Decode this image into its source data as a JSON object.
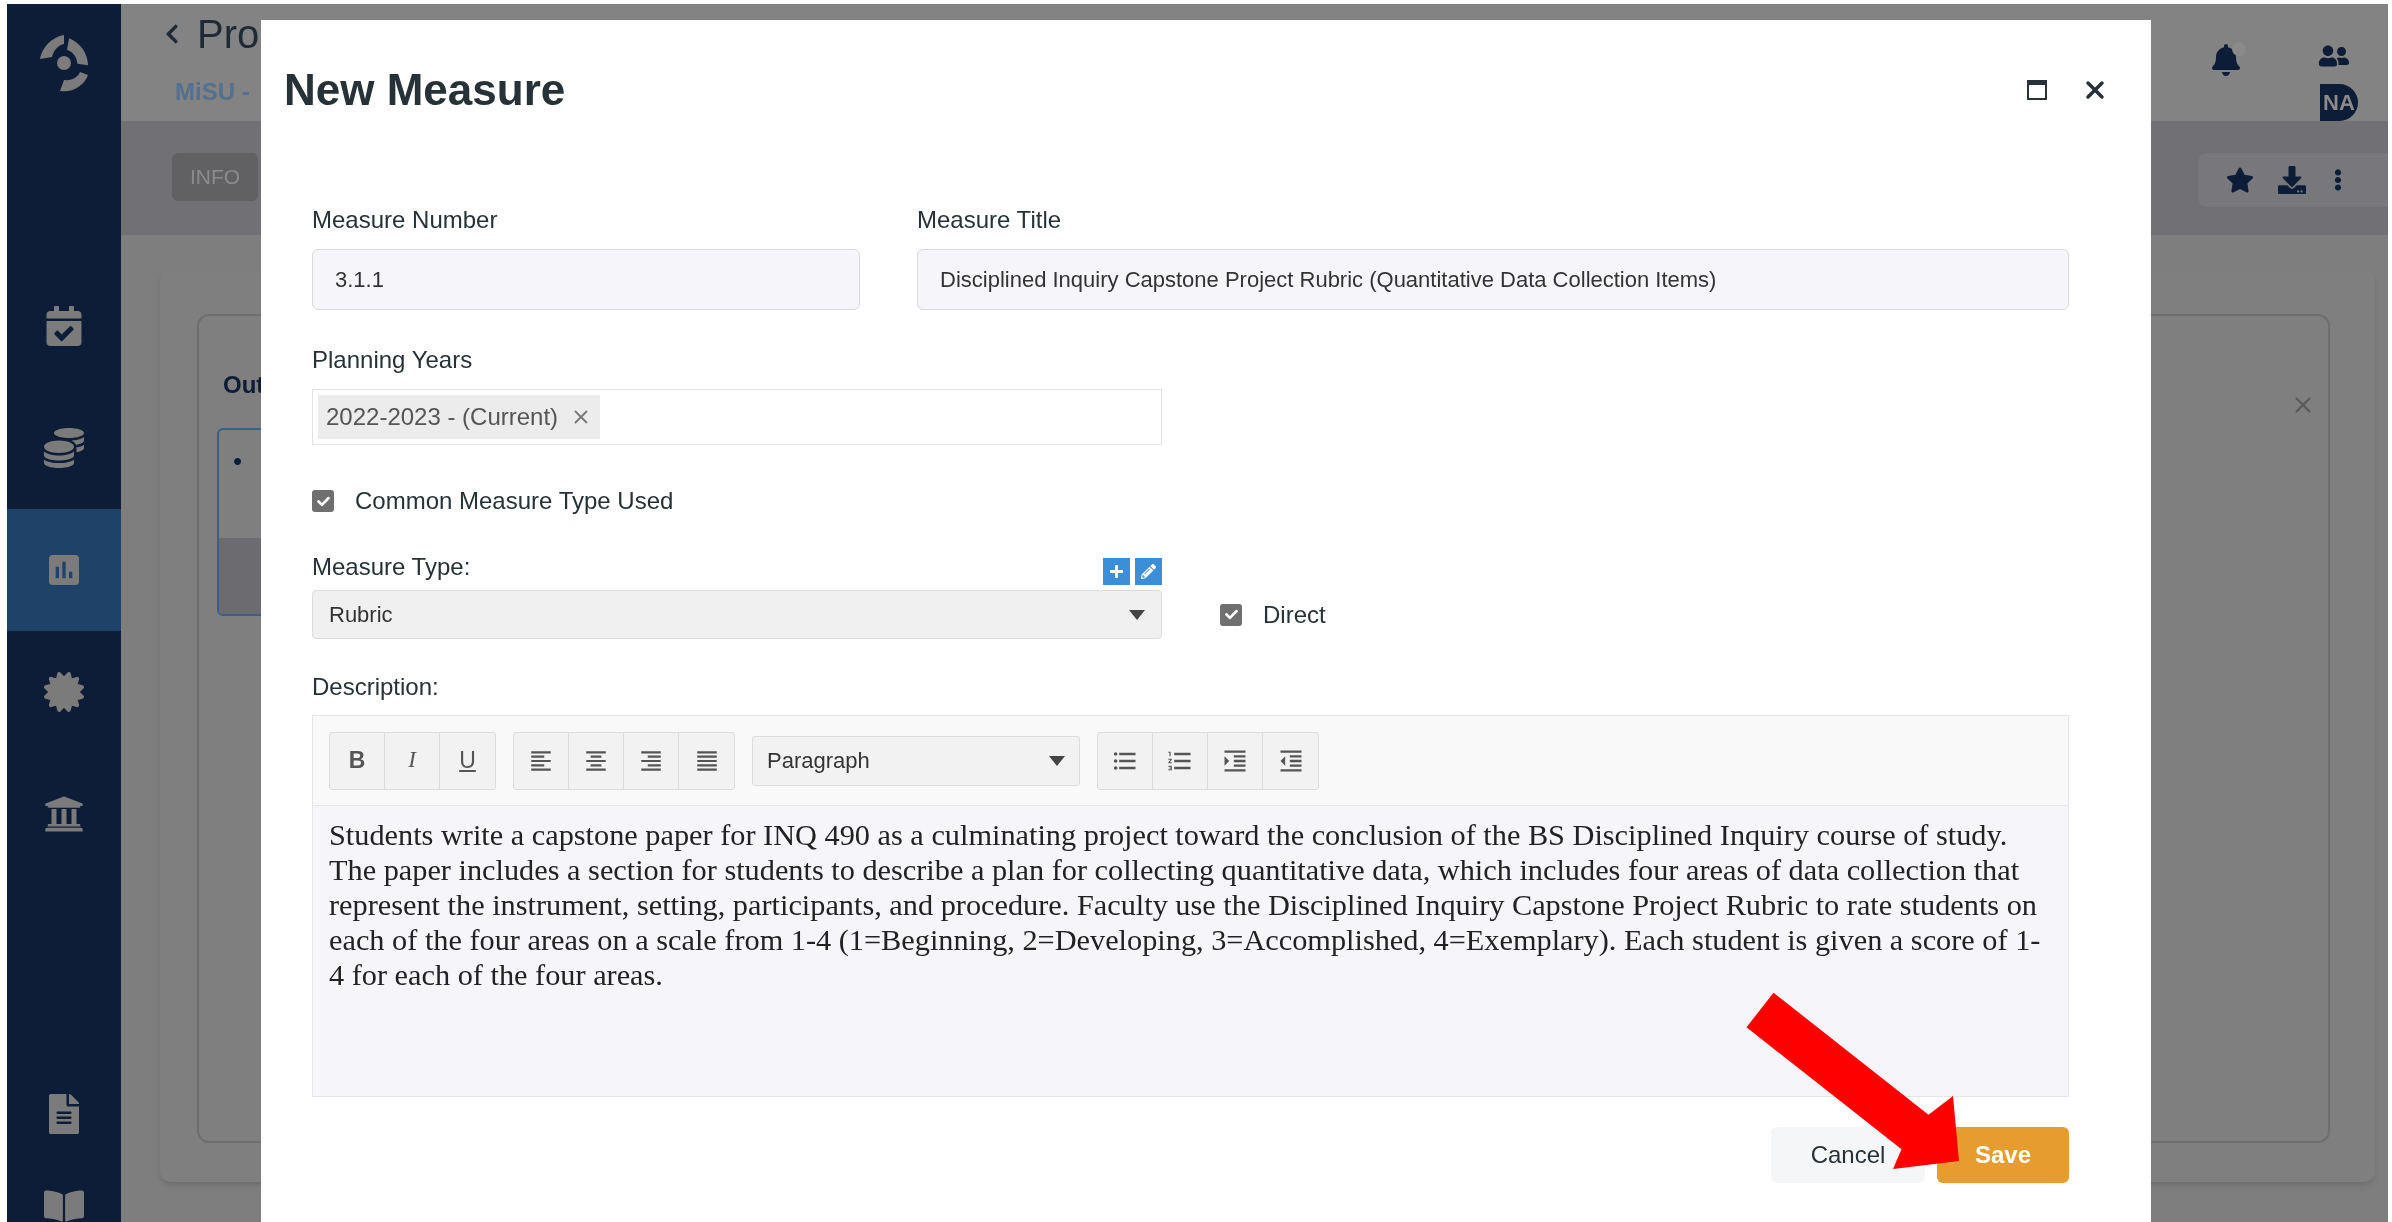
{
  "sidebar": {
    "items": [
      {
        "selected": false
      },
      {
        "selected": false
      },
      {
        "selected": true
      },
      {
        "selected": false
      },
      {
        "selected": false
      },
      {
        "selected": false
      },
      {
        "selected": false
      }
    ]
  },
  "header": {
    "title": "Pro",
    "subtitle": "MiSU -",
    "tab": "INFO",
    "avatar": "NA"
  },
  "card": {
    "heading": "Out",
    "item": "•"
  },
  "dialog": {
    "title": "New Measure",
    "measure_number": {
      "label": "Measure Number",
      "value": "3.1.1"
    },
    "measure_title": {
      "label": "Measure Title",
      "value": "Disciplined Inquiry Capstone Project Rubric (Quantitative Data Collection Items)"
    },
    "planning_years": {
      "label": "Planning Years",
      "chips": [
        "2022-2023 - (Current)"
      ]
    },
    "common_measure": {
      "label": "Common Measure Type Used",
      "checked": true
    },
    "measure_type": {
      "label": "Measure Type:",
      "value": "Rubric"
    },
    "direct": {
      "label": "Direct",
      "checked": true
    },
    "description": {
      "label": "Description:",
      "format_buttons": [
        "B",
        "I",
        "U"
      ],
      "block_format": "Paragraph",
      "text": "Students write a capstone paper for INQ 490 as a culminating project toward the conclusion of the BS Disciplined Inquiry course of study. The paper includes a section for students to describe a plan for collecting quantitative data, which includes four areas of data collection that represent the instrument, setting, participants, and procedure. Faculty use the Disciplined Inquiry Capstone Project Rubric to rate students on each of the four areas on a scale from 1-4 (1=Beginning, 2=Developing, 3=Accomplished, 4=Exemplary). Each student is given a score of 1-4 for each of the four areas."
    },
    "buttons": {
      "cancel": "Cancel",
      "save": "Save"
    }
  }
}
